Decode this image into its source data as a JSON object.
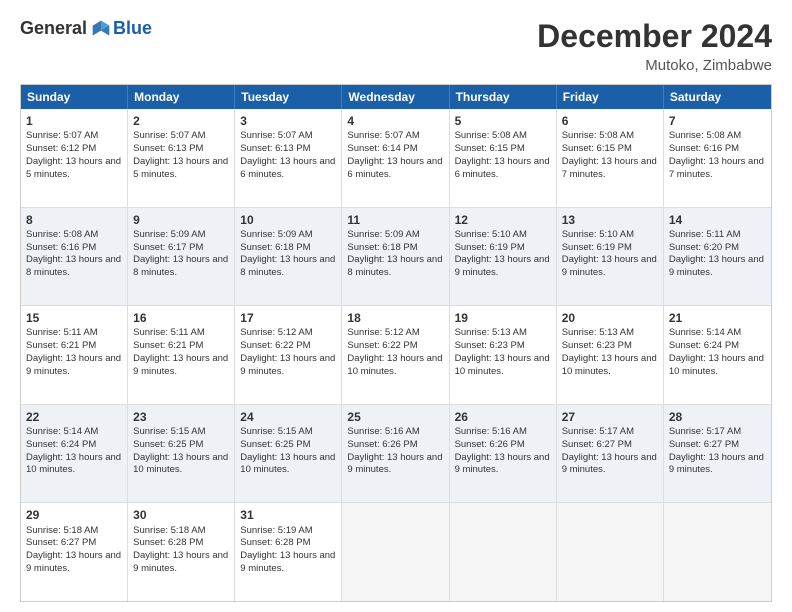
{
  "logo": {
    "general": "General",
    "blue": "Blue"
  },
  "header": {
    "title": "December 2024",
    "subtitle": "Mutoko, Zimbabwe"
  },
  "weekdays": [
    "Sunday",
    "Monday",
    "Tuesday",
    "Wednesday",
    "Thursday",
    "Friday",
    "Saturday"
  ],
  "rows": [
    [
      {
        "day": "1",
        "info": "Sunrise: 5:07 AM\nSunset: 6:12 PM\nDaylight: 13 hours and 5 minutes."
      },
      {
        "day": "2",
        "info": "Sunrise: 5:07 AM\nSunset: 6:13 PM\nDaylight: 13 hours and 5 minutes."
      },
      {
        "day": "3",
        "info": "Sunrise: 5:07 AM\nSunset: 6:13 PM\nDaylight: 13 hours and 6 minutes."
      },
      {
        "day": "4",
        "info": "Sunrise: 5:07 AM\nSunset: 6:14 PM\nDaylight: 13 hours and 6 minutes."
      },
      {
        "day": "5",
        "info": "Sunrise: 5:08 AM\nSunset: 6:15 PM\nDaylight: 13 hours and 6 minutes."
      },
      {
        "day": "6",
        "info": "Sunrise: 5:08 AM\nSunset: 6:15 PM\nDaylight: 13 hours and 7 minutes."
      },
      {
        "day": "7",
        "info": "Sunrise: 5:08 AM\nSunset: 6:16 PM\nDaylight: 13 hours and 7 minutes."
      }
    ],
    [
      {
        "day": "8",
        "info": "Sunrise: 5:08 AM\nSunset: 6:16 PM\nDaylight: 13 hours and 8 minutes."
      },
      {
        "day": "9",
        "info": "Sunrise: 5:09 AM\nSunset: 6:17 PM\nDaylight: 13 hours and 8 minutes."
      },
      {
        "day": "10",
        "info": "Sunrise: 5:09 AM\nSunset: 6:18 PM\nDaylight: 13 hours and 8 minutes."
      },
      {
        "day": "11",
        "info": "Sunrise: 5:09 AM\nSunset: 6:18 PM\nDaylight: 13 hours and 8 minutes."
      },
      {
        "day": "12",
        "info": "Sunrise: 5:10 AM\nSunset: 6:19 PM\nDaylight: 13 hours and 9 minutes."
      },
      {
        "day": "13",
        "info": "Sunrise: 5:10 AM\nSunset: 6:19 PM\nDaylight: 13 hours and 9 minutes."
      },
      {
        "day": "14",
        "info": "Sunrise: 5:11 AM\nSunset: 6:20 PM\nDaylight: 13 hours and 9 minutes."
      }
    ],
    [
      {
        "day": "15",
        "info": "Sunrise: 5:11 AM\nSunset: 6:21 PM\nDaylight: 13 hours and 9 minutes."
      },
      {
        "day": "16",
        "info": "Sunrise: 5:11 AM\nSunset: 6:21 PM\nDaylight: 13 hours and 9 minutes."
      },
      {
        "day": "17",
        "info": "Sunrise: 5:12 AM\nSunset: 6:22 PM\nDaylight: 13 hours and 9 minutes."
      },
      {
        "day": "18",
        "info": "Sunrise: 5:12 AM\nSunset: 6:22 PM\nDaylight: 13 hours and 10 minutes."
      },
      {
        "day": "19",
        "info": "Sunrise: 5:13 AM\nSunset: 6:23 PM\nDaylight: 13 hours and 10 minutes."
      },
      {
        "day": "20",
        "info": "Sunrise: 5:13 AM\nSunset: 6:23 PM\nDaylight: 13 hours and 10 minutes."
      },
      {
        "day": "21",
        "info": "Sunrise: 5:14 AM\nSunset: 6:24 PM\nDaylight: 13 hours and 10 minutes."
      }
    ],
    [
      {
        "day": "22",
        "info": "Sunrise: 5:14 AM\nSunset: 6:24 PM\nDaylight: 13 hours and 10 minutes."
      },
      {
        "day": "23",
        "info": "Sunrise: 5:15 AM\nSunset: 6:25 PM\nDaylight: 13 hours and 10 minutes."
      },
      {
        "day": "24",
        "info": "Sunrise: 5:15 AM\nSunset: 6:25 PM\nDaylight: 13 hours and 10 minutes."
      },
      {
        "day": "25",
        "info": "Sunrise: 5:16 AM\nSunset: 6:26 PM\nDaylight: 13 hours and 9 minutes."
      },
      {
        "day": "26",
        "info": "Sunrise: 5:16 AM\nSunset: 6:26 PM\nDaylight: 13 hours and 9 minutes."
      },
      {
        "day": "27",
        "info": "Sunrise: 5:17 AM\nSunset: 6:27 PM\nDaylight: 13 hours and 9 minutes."
      },
      {
        "day": "28",
        "info": "Sunrise: 5:17 AM\nSunset: 6:27 PM\nDaylight: 13 hours and 9 minutes."
      }
    ],
    [
      {
        "day": "29",
        "info": "Sunrise: 5:18 AM\nSunset: 6:27 PM\nDaylight: 13 hours and 9 minutes."
      },
      {
        "day": "30",
        "info": "Sunrise: 5:18 AM\nSunset: 6:28 PM\nDaylight: 13 hours and 9 minutes."
      },
      {
        "day": "31",
        "info": "Sunrise: 5:19 AM\nSunset: 6:28 PM\nDaylight: 13 hours and 9 minutes."
      },
      {
        "day": "",
        "info": ""
      },
      {
        "day": "",
        "info": ""
      },
      {
        "day": "",
        "info": ""
      },
      {
        "day": "",
        "info": ""
      }
    ]
  ],
  "alt_rows": [
    1,
    3
  ],
  "colors": {
    "header_bg": "#1a5fa8",
    "header_text": "#ffffff",
    "alt_row_bg": "#eef2f7",
    "border": "#cccccc"
  }
}
